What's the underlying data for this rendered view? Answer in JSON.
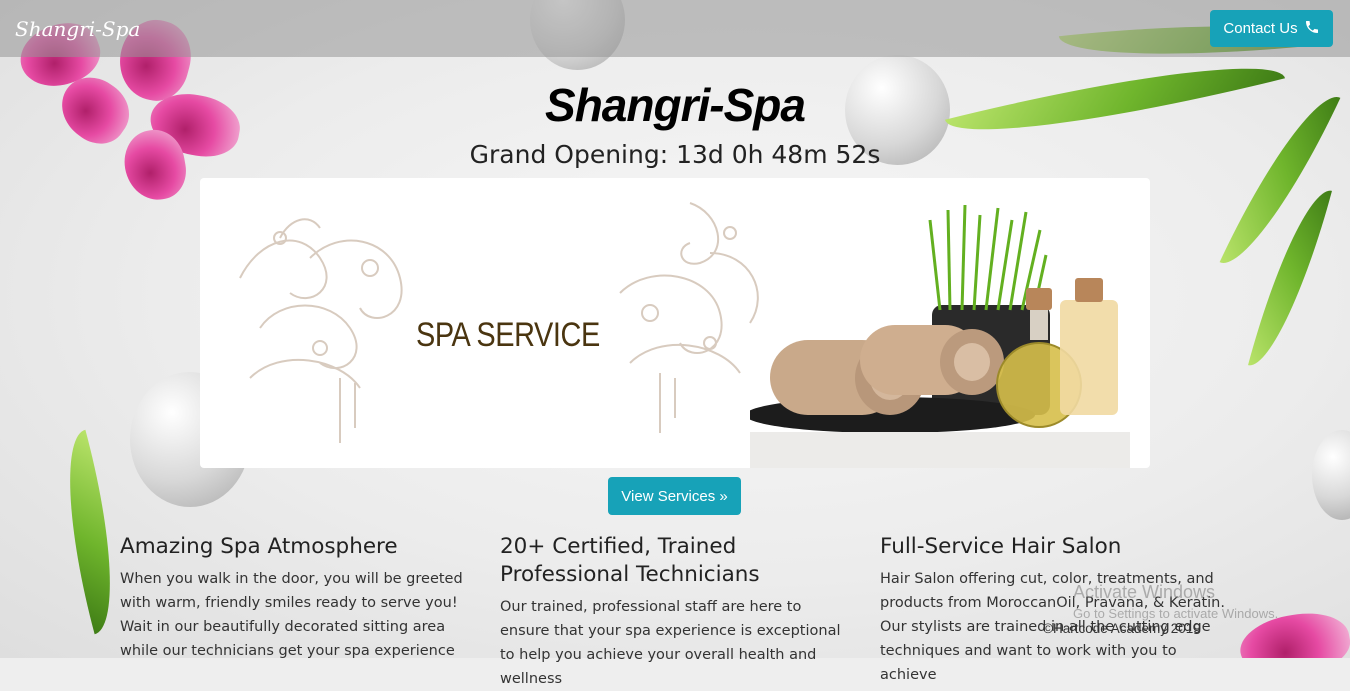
{
  "navbar": {
    "brand": "Shangri-Spa",
    "contact_label": "Contact Us",
    "contact_icon": "phone-icon"
  },
  "hero": {
    "title": "Shangri-Spa",
    "countdown": "Grand Opening: 13d 0h 48m 52s",
    "banner_text": "SPA SERVICE",
    "view_services_label": "View Services »"
  },
  "features": [
    {
      "title": "Amazing Spa Atmosphere",
      "text": "When you walk in the door, you will be greeted with warm, friendly smiles ready to serve you! Wait in our beautifully decorated sitting area while our technicians get your spa experience"
    },
    {
      "title": "20+ Certified, Trained Professional Technicians",
      "text": "Our trained, professional staff are here to ensure that your spa experience is exceptional to help you achieve your overall health and wellness"
    },
    {
      "title": "Full-Service Hair Salon",
      "text": "Hair Salon offering cut, color, treatments, and products from MoroccanOil, Pravana, & Keratin. Our stylists are trained in all the cutting edge techniques and want to work with you to achieve"
    }
  ],
  "footer": {
    "copyright": "©Hartcode Academy 2019"
  },
  "watermark": {
    "title": "Activate Windows",
    "subtitle": "Go to Settings to activate Windows."
  },
  "colors": {
    "accent": "#17a2b8",
    "banner_text": "#4a3510"
  }
}
